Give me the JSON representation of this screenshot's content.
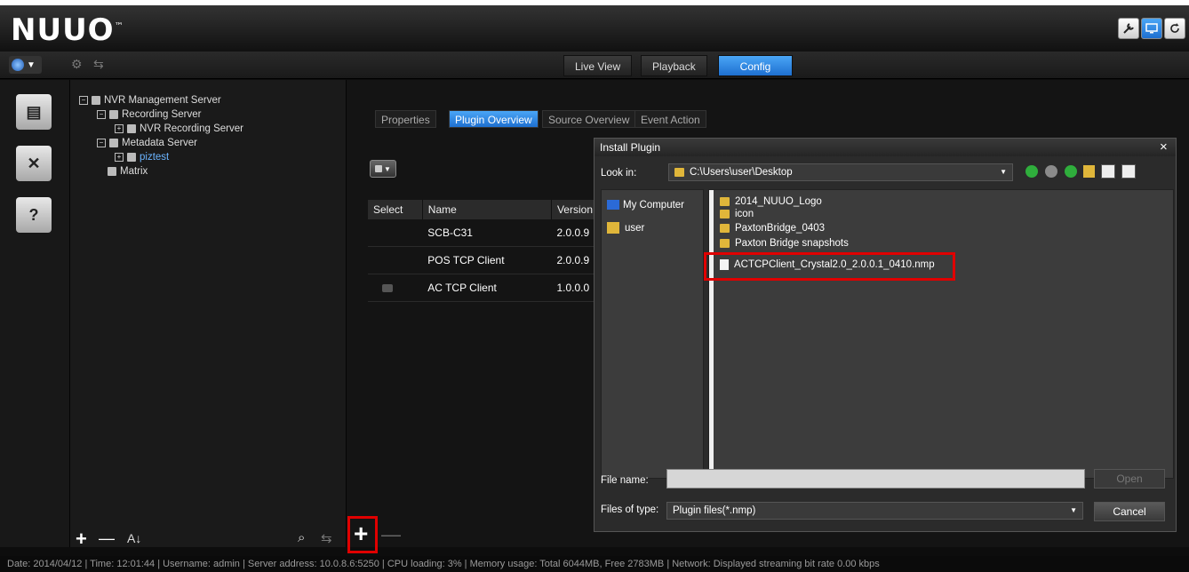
{
  "header": {
    "logo": "NUUO",
    "logo_tm": "™"
  },
  "main_tabs": [
    {
      "label": "Live View"
    },
    {
      "label": "Playback"
    },
    {
      "label": "Config"
    }
  ],
  "tree": [
    {
      "label": "NVR Management Server"
    },
    {
      "label": "Recording Server"
    },
    {
      "label": "NVR Recording Server"
    },
    {
      "label": "Metadata Server"
    },
    {
      "label": "piztest"
    },
    {
      "label": "Matrix"
    }
  ],
  "sub_tabs": [
    {
      "label": "Properties"
    },
    {
      "label": "Plugin Overview"
    },
    {
      "label": "Source Overview"
    },
    {
      "label": "Event Action"
    }
  ],
  "plugin_table": {
    "headers": [
      "Select",
      "Name",
      "Version"
    ],
    "rows": [
      {
        "name": "SCB-C31",
        "version": "2.0.0.9"
      },
      {
        "name": "POS TCP Client",
        "version": "2.0.0.9"
      },
      {
        "name": "AC TCP Client",
        "version": "1.0.0.0"
      }
    ]
  },
  "dialog": {
    "title": "Install Plugin",
    "close": "×",
    "look_in_label": "Look in:",
    "look_in_value": "C:\\Users\\user\\Desktop",
    "places": [
      {
        "label": "My Computer"
      },
      {
        "label": "user"
      }
    ],
    "files": [
      {
        "name": "2014_NUUO_Logo"
      },
      {
        "name": "icon"
      },
      {
        "name": "PaxtonBridge_0403"
      },
      {
        "name": "Paxton Bridge snapshots"
      },
      {
        "name": "ACTCPClient_Crystal2.0_2.0.0.1_0410.nmp"
      }
    ],
    "file_name_label": "File name:",
    "file_name_value": "",
    "files_of_type_label": "Files of type:",
    "files_of_type_value": "Plugin files(*.nmp)",
    "open_label": "Open",
    "cancel_label": "Cancel"
  },
  "status_bar": "Date: 2014/04/12 | Time: 12:01:44 | Username: admin | Server address: 10.0.8.6:5250 | CPU loading: 3% | Memory usage: Total 6044MB, Free 2783MB | Network: Displayed streaming bit rate    0.00 kbps",
  "bottom_bar": {
    "add": "+",
    "remove": "—",
    "sort": "↓"
  },
  "colors": {
    "accent": "#2e86e6",
    "highlight": "#e00000"
  }
}
